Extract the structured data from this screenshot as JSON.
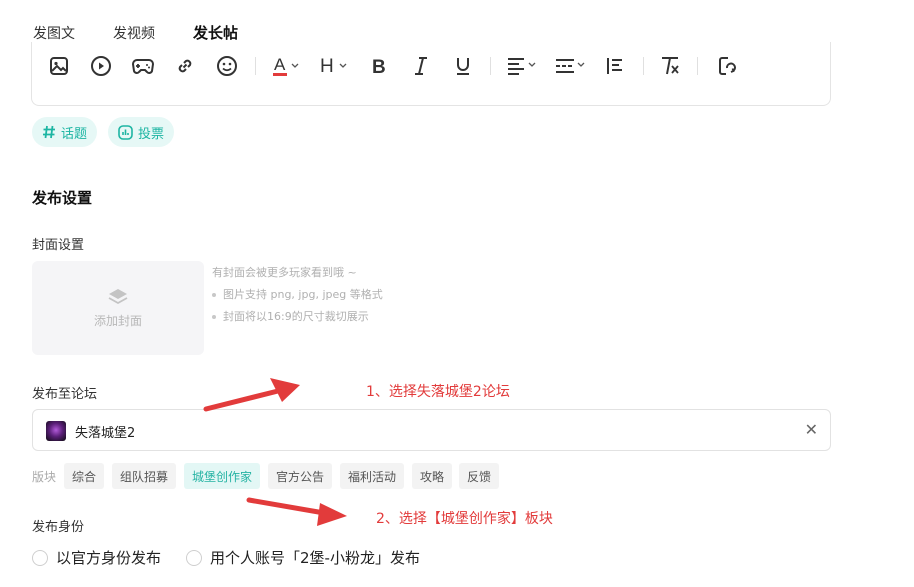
{
  "tabs": [
    {
      "label": "发图文"
    },
    {
      "label": "发视频"
    },
    {
      "label": "发长帖"
    }
  ],
  "toolbar": {
    "icons": [
      "image-icon",
      "video-icon",
      "gamepad-icon",
      "link-icon",
      "emoji-icon",
      "font-color-icon",
      "heading-icon",
      "bold-icon",
      "italic-icon",
      "underline-icon",
      "align-icon",
      "divider-icon",
      "list-icon",
      "clear-format-icon",
      "redo-icon"
    ],
    "font_color_accent": "#e23b3b"
  },
  "chips": {
    "topic": "话题",
    "vote": "投票"
  },
  "publish_settings": {
    "title": "发布设置",
    "cover": {
      "label": "封面设置",
      "add_label": "添加封面",
      "hint_title": "有封面会被更多玩家看到哦 ~",
      "hints": [
        "图片支持 png, jpg, jpeg 等格式",
        "封面将以16:9的尺寸裁切展示"
      ]
    },
    "forum": {
      "label": "发布至论坛",
      "selected": "失落城堡2",
      "board_label": "版块",
      "boards": [
        "综合",
        "组队招募",
        "城堡创作家",
        "官方公告",
        "福利活动",
        "攻略",
        "反馈"
      ],
      "selected_board": "城堡创作家"
    },
    "identity": {
      "label": "发布身份",
      "options": [
        "以官方身份发布",
        "用个人账号「2堡-小粉龙」发布"
      ]
    }
  },
  "annotations": {
    "step1": "1、选择失落城堡2论坛",
    "step2": "2、选择【城堡创作家】板块",
    "color": "#e23b3b"
  },
  "colors": {
    "accent": "#2dd4bf",
    "chip_bg": "#e6f8f6",
    "chip_text": "#1db5a3"
  }
}
